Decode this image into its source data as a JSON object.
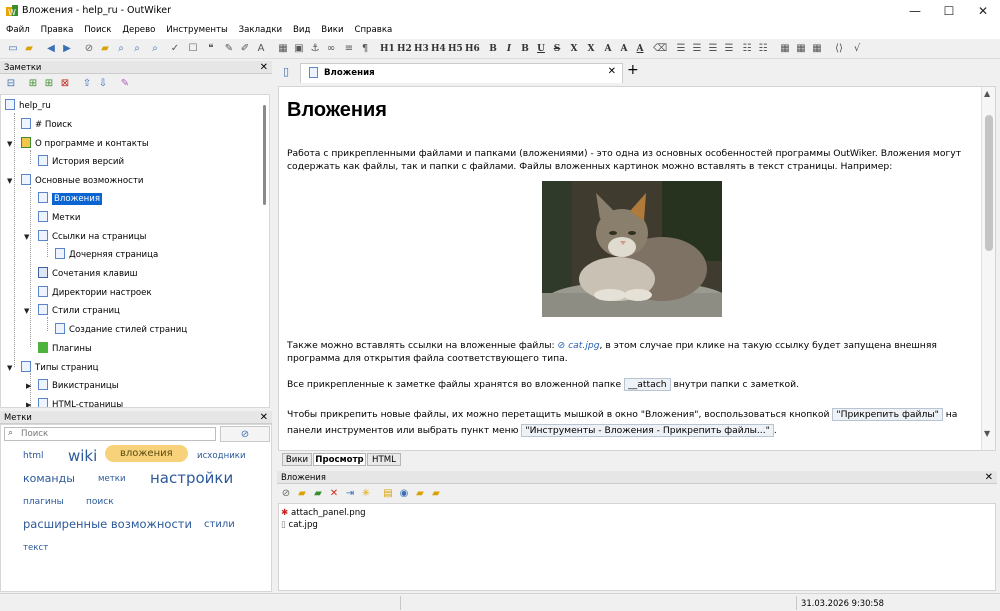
{
  "window": {
    "title": "Вложения - help_ru - OutWiker",
    "minimize": "—",
    "maximize": "☐",
    "close": "✕"
  },
  "menu": [
    "Файл",
    "Правка",
    "Поиск",
    "Дерево",
    "Инструменты",
    "Закладки",
    "Вид",
    "Вики",
    "Справка"
  ],
  "toolbar": {
    "format_buttons": [
      "H1",
      "H2",
      "H3",
      "H4",
      "H5",
      "H6",
      "B",
      "I",
      "B",
      "U",
      "S",
      "X",
      "X",
      "A",
      "A",
      "A"
    ]
  },
  "notes_pane": {
    "title": "Заметки",
    "tree": [
      {
        "label": "help_ru",
        "icon": "page-icon"
      },
      {
        "label": "# Поиск",
        "icon": "search-page-icon"
      },
      {
        "label": "О программе и контакты",
        "icon": "outwiker-logo-icon"
      },
      {
        "label": "История версий",
        "icon": "page-icon"
      },
      {
        "label": "Основные возможности",
        "icon": "page-icon"
      },
      {
        "label": "Вложения",
        "icon": "page-icon",
        "selected": true
      },
      {
        "label": "Метки",
        "icon": "page-icon"
      },
      {
        "label": "Ссылки на страницы",
        "icon": "page-icon"
      },
      {
        "label": "Дочерняя страница",
        "icon": "page-icon"
      },
      {
        "label": "Сочетания клавиш",
        "icon": "keyboard-icon"
      },
      {
        "label": "Директории настроек",
        "icon": "page-icon"
      },
      {
        "label": "Стили страниц",
        "icon": "page-icon"
      },
      {
        "label": "Создание стилей страниц",
        "icon": "page-icon"
      },
      {
        "label": "Плагины",
        "icon": "plugin-icon"
      },
      {
        "label": "Типы страниц",
        "icon": "page-icon"
      },
      {
        "label": "Викистраницы",
        "icon": "page-icon"
      },
      {
        "label": "HTML-страницы",
        "icon": "page-icon"
      }
    ]
  },
  "tags_pane": {
    "title": "Метки",
    "search_placeholder": "Поиск",
    "tags": [
      "html",
      "wiki",
      "вложения",
      "исходники",
      "команды",
      "метки",
      "настройки",
      "плагины",
      "поиск",
      "расширенные возможности",
      "стили",
      "текст"
    ]
  },
  "editor": {
    "tab_title": "Вложения",
    "add_tab": "+",
    "heading": "Вложения",
    "p1": "Работа с прикрепленными файлами и папками (вложениями) - это одна из основных особенностей программы OutWiker. Вложения могут содержать как файлы, так и папки с файлами. Файлы вложенных картинок можно вставлять в текст страницы. Например:",
    "p2_a": "Также можно вставлять ссылки на вложенные файлы: ",
    "p2_link": "cat.jpg",
    "p2_b": ", в этом случае при клике на такую ссылку будет запущена внешняя программа для открытия файла соответствующего типа.",
    "p3_a": "Все прикрепленные к заметке файлы хранятся во вложенной папке ",
    "p3_code": "__attach",
    "p3_b": " внутри папки с заметкой.",
    "p4_a": "Чтобы прикрепить новые файлы, их можно перетащить мышкой в окно \"Вложения\", воспользоваться кнопкой ",
    "p4_code1": "\"Прикрепить файлы\"",
    "p4_b": " на панели инструментов или выбрать пункт меню ",
    "p4_code2": "\"Инструменты - Вложения - Прикрепить файлы...\"",
    "p4_c": ".",
    "view_tabs": [
      "Вики",
      "Просмотр",
      "HTML"
    ],
    "active_view": "Просмотр"
  },
  "attachments": {
    "title": "Вложения",
    "files": [
      "attach_panel.png",
      "cat.jpg"
    ]
  },
  "status": {
    "datetime": "31.03.2026 9:30:58"
  },
  "colors": {
    "selection": "#0a64d2",
    "tag": "#2c5a9b",
    "tag_highlight": "#f7d27a"
  }
}
